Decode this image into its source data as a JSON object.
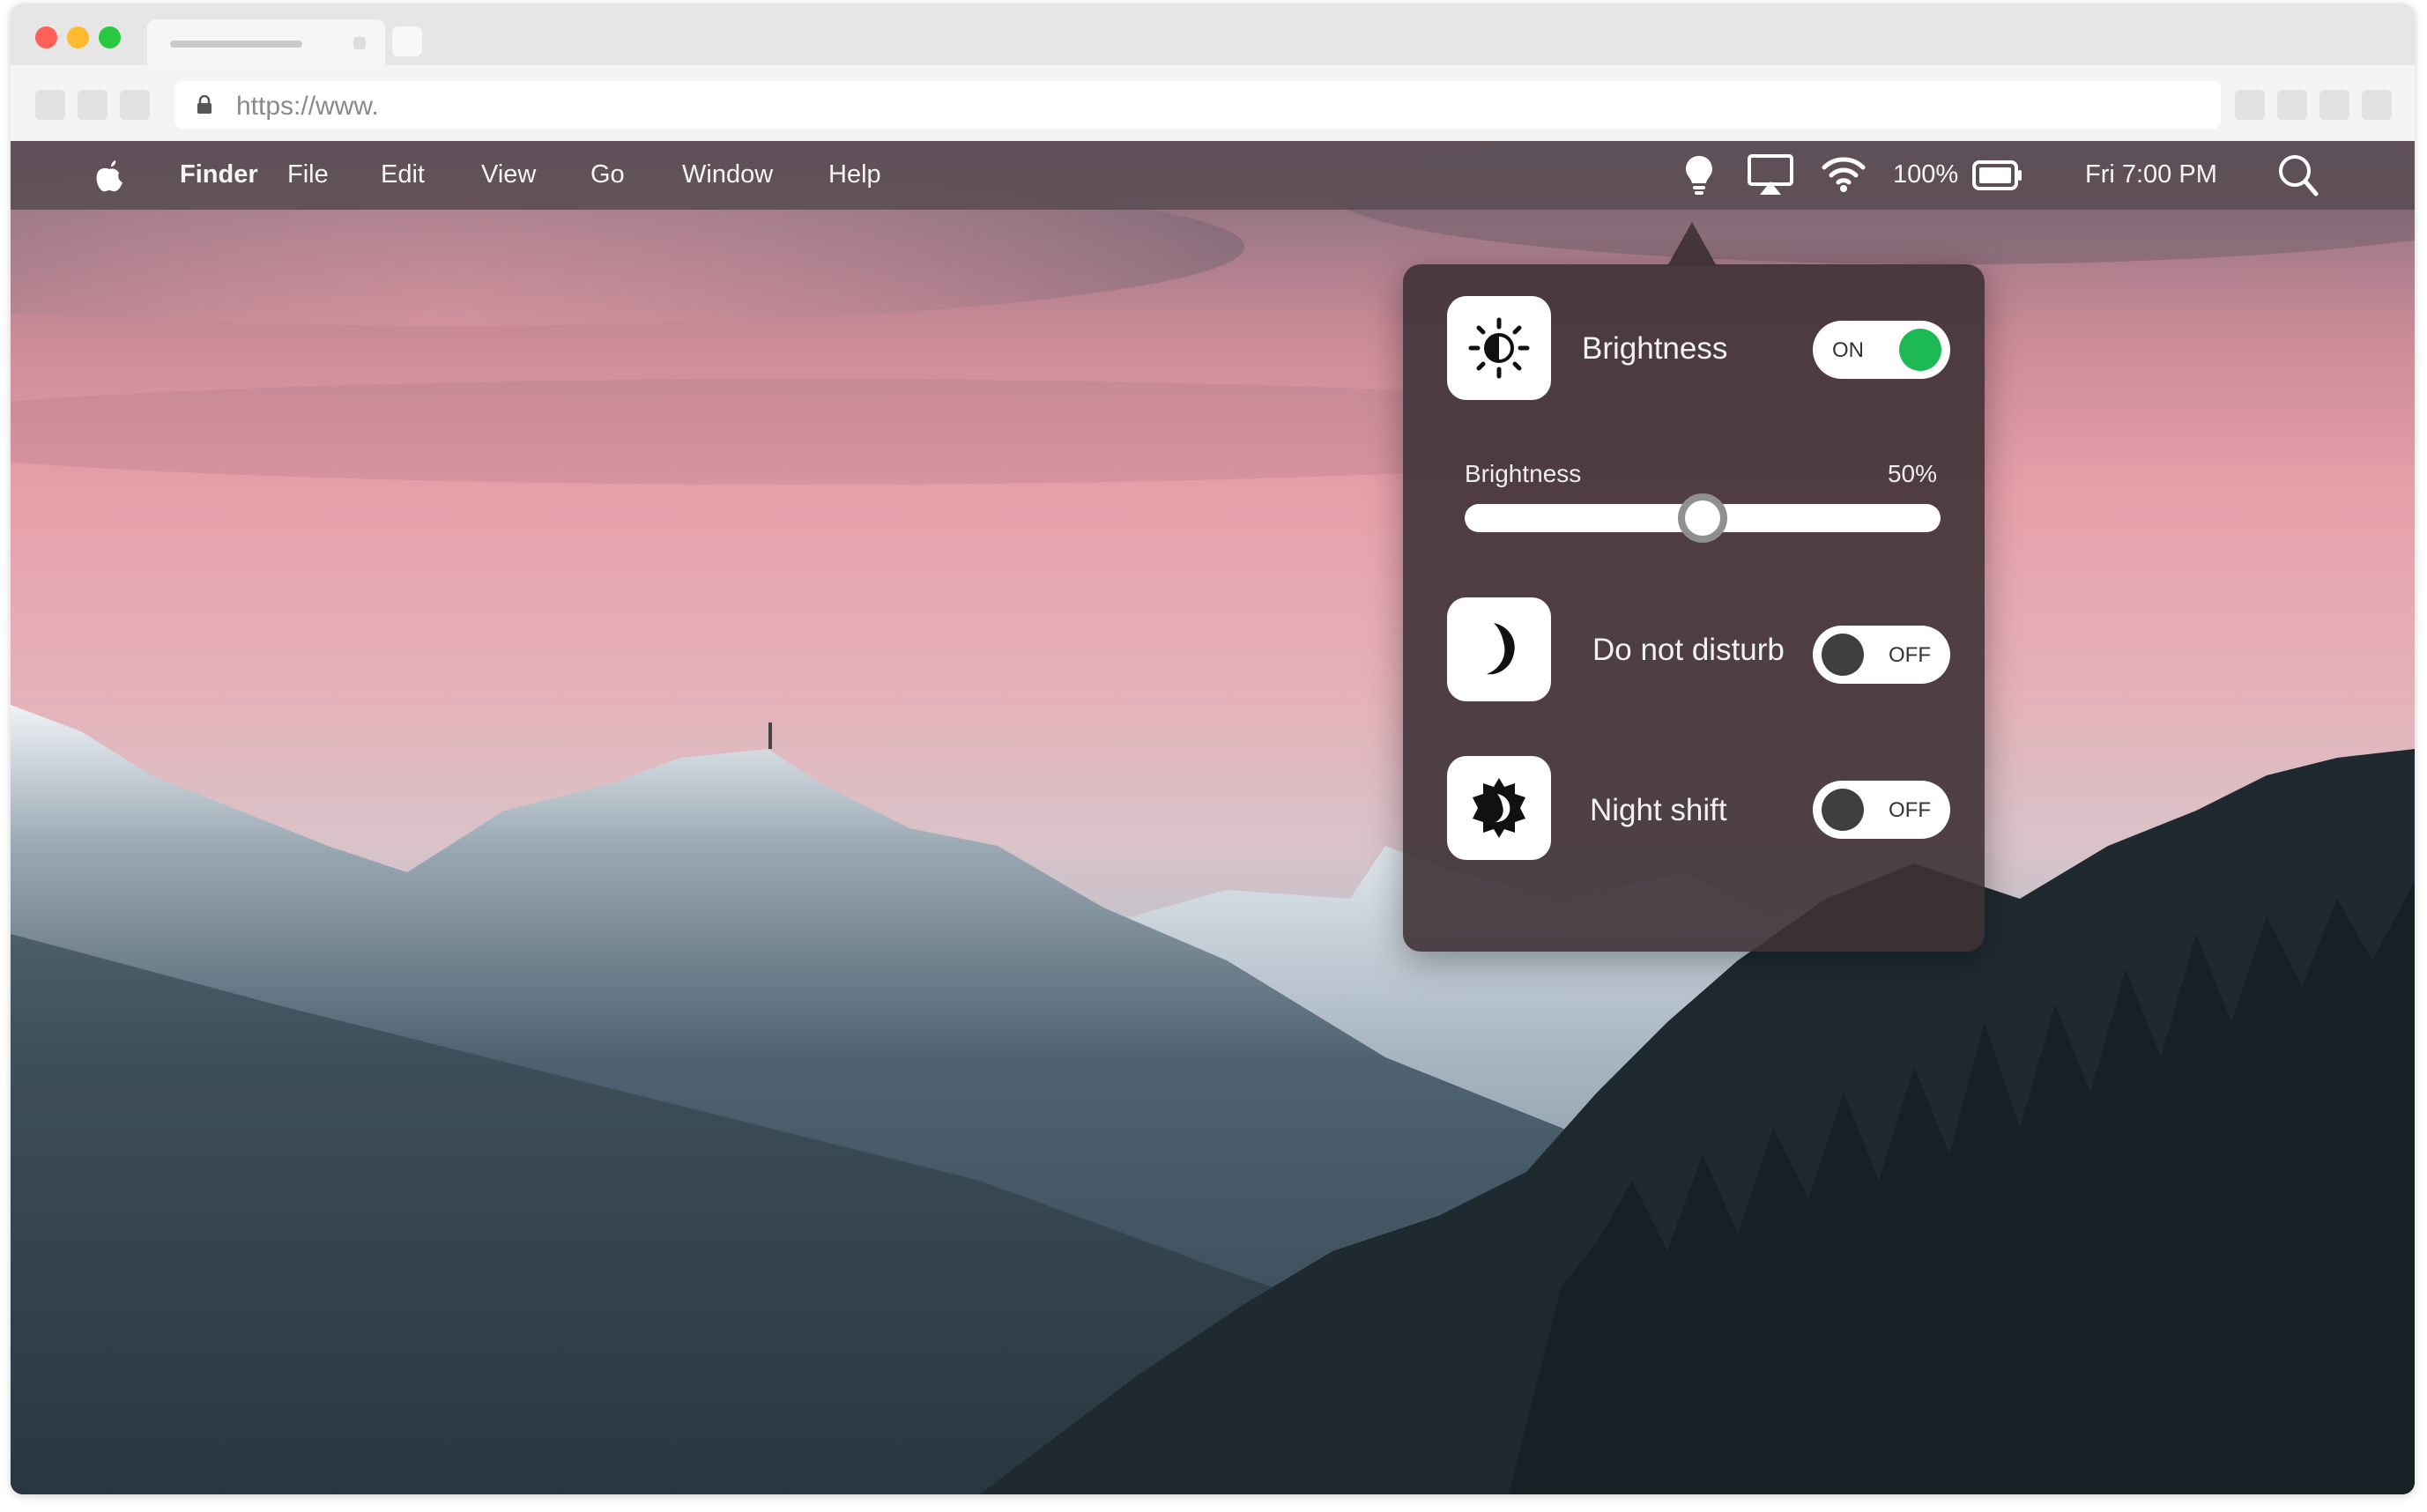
{
  "browser": {
    "url": "https://www."
  },
  "menubar": {
    "app_name": "Finder",
    "items": [
      "File",
      "Edit",
      "View",
      "Go",
      "Window",
      "Help"
    ],
    "battery_percent": "100%",
    "clock": "Fri 7:00 PM"
  },
  "popover": {
    "brightness": {
      "label": "Brightness",
      "toggle_label": "ON",
      "toggle_on": true
    },
    "slider": {
      "label": "Brightness",
      "value_text": "50%",
      "value": 0.5
    },
    "do_not_disturb": {
      "label": "Do not disturb",
      "toggle_label": "OFF",
      "toggle_on": false
    },
    "night_shift": {
      "label": "Night shift",
      "toggle_label": "OFF",
      "toggle_on": false
    }
  },
  "colors": {
    "toggle_on_knob": "#1db954",
    "toggle_off_knob": "#3f3f3f",
    "menubar_bg": "#5c4e56",
    "popover_bg": "#3e3236"
  },
  "icons": {
    "menubar": [
      "apple-icon",
      "lightbulb-icon",
      "airplay-icon",
      "wifi-icon",
      "battery-icon",
      "search-icon"
    ],
    "popover": [
      "sun-icon",
      "moon-icon",
      "night-shift-icon"
    ]
  }
}
